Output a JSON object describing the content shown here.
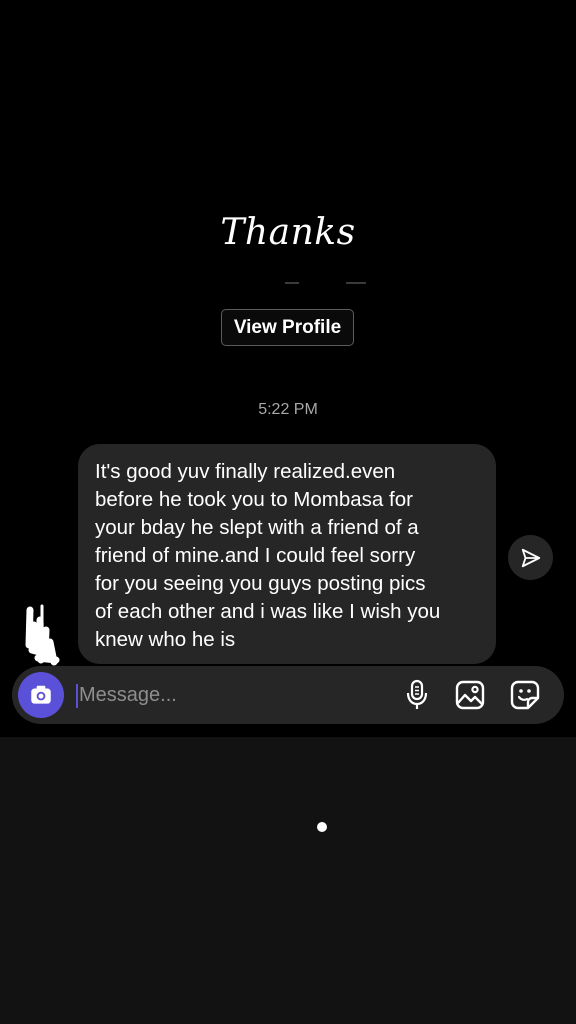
{
  "story": {
    "caption": "Thanks"
  },
  "profile": {
    "view_profile_label": "View Profile"
  },
  "thread": {
    "timestamp": "5:22 PM",
    "messages": [
      {
        "text": "It's good yuv finally realized.even\nbefore he took you to Mombasa for\nyour bday he slept with a friend of a\nfriend of mine.and I could feel sorry\nfor you seeing you guys posting pics\nof each other and i was like I wish you\nknew who he is"
      }
    ]
  },
  "composer": {
    "placeholder": "Message...",
    "value": "",
    "icons": [
      "camera-icon",
      "microphone-icon",
      "gallery-icon",
      "sticker-icon"
    ]
  },
  "pagination": {
    "active_dot": 1
  },
  "colors": {
    "background": "#121212",
    "panel": "#000000",
    "bubble": "#262626",
    "accent": "#5b51d8",
    "muted_text": "#a8a8a8"
  }
}
